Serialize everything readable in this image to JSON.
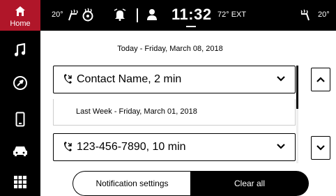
{
  "sidebar": {
    "home_label": "Home",
    "items": [
      {
        "icon": "home-icon"
      },
      {
        "icon": "music-icon"
      },
      {
        "icon": "navigation-icon"
      },
      {
        "icon": "phone-icon"
      },
      {
        "icon": "car-icon"
      },
      {
        "icon": "apps-grid-icon"
      }
    ]
  },
  "status_bar": {
    "left_temp": "20°",
    "time": "11:32",
    "ext_temp": "72° EXT",
    "right_temp": "20°"
  },
  "main": {
    "today_header": "Today - Friday, March 08, 2018",
    "entries": [
      {
        "text": "Contact Name, 2 min"
      },
      {
        "text": "123-456-7890, 10 min"
      }
    ],
    "last_week_header": "Last Week - Friday, March 01, 2018"
  },
  "buttons": {
    "notification_settings": "Notification settings",
    "clear_all": "Clear all"
  },
  "colors": {
    "accent": "#b01629",
    "bar": "#000000"
  }
}
